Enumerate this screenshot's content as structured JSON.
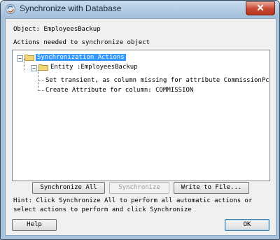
{
  "window": {
    "title": "Synchronize with Database",
    "close_icon": "close-icon"
  },
  "object_label": "Object: EmployeesBackup",
  "actions_label": "Actions needed to synchronize object",
  "tree": {
    "root": "Synchronization Actions",
    "entity": "Entity :EmployeesBackup",
    "actions": [
      "Set transient, as column missing for attribute CommissionPct",
      "Create Attribute for column: COMMISSION"
    ]
  },
  "buttons": {
    "sync_all": "Synchronize All",
    "sync": "Synchronize",
    "write_file": "Write to File...",
    "help": "Help",
    "ok": "OK"
  },
  "hint_lines": [
    "Hint: Click Synchronize All to perform all automatic actions or",
    "select actions to perform and click Synchronize"
  ]
}
